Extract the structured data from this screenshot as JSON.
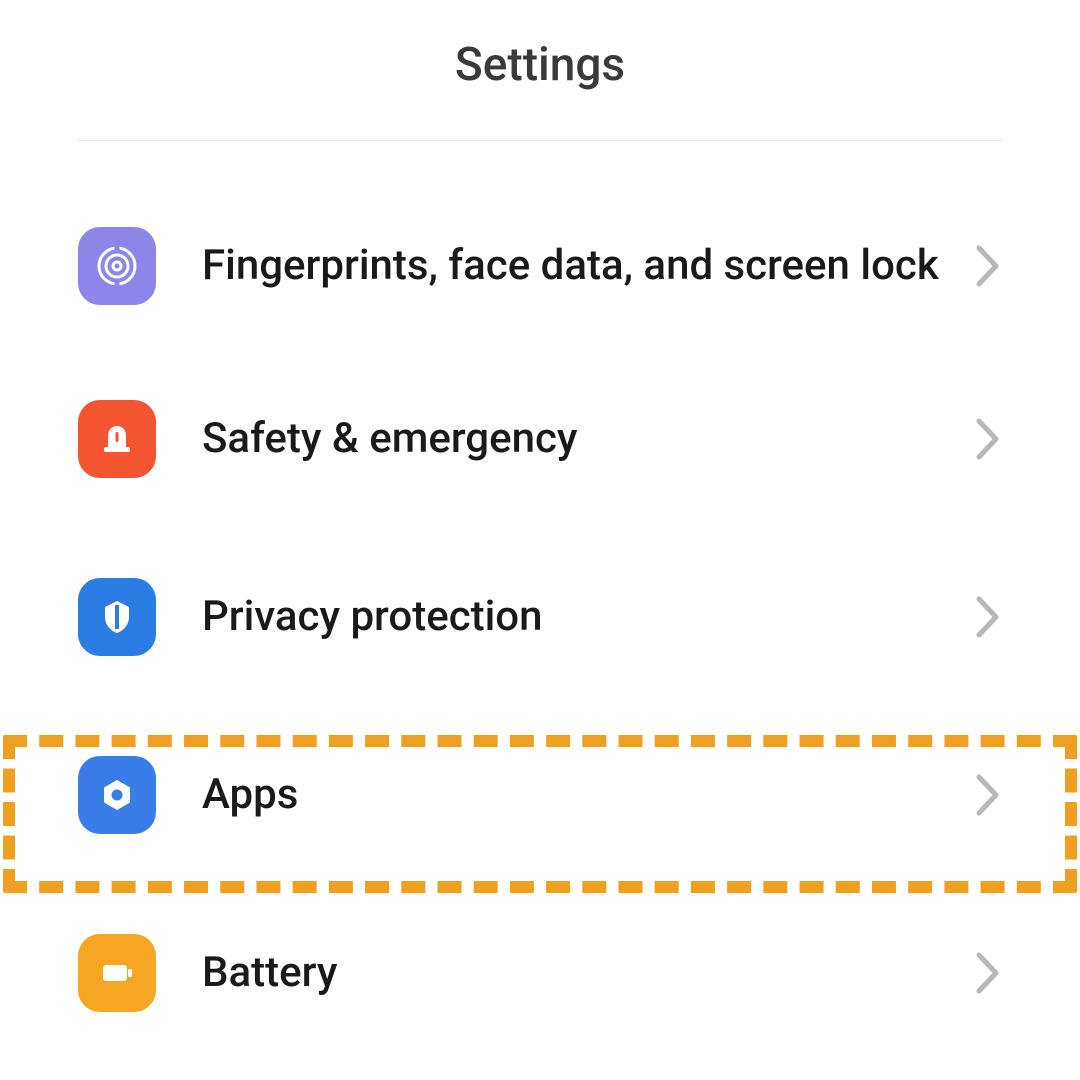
{
  "header": {
    "title": "Settings"
  },
  "list": {
    "items": [
      {
        "label": "Fingerprints, face data, and screen lock",
        "iconColor": "purple",
        "iconName": "fingerprint-icon"
      },
      {
        "label": "Safety & emergency",
        "iconColor": "orange",
        "iconName": "alert-icon"
      },
      {
        "label": "Privacy protection",
        "iconColor": "blue",
        "iconName": "shield-icon"
      },
      {
        "label": "Apps",
        "iconColor": "blue2",
        "iconName": "apps-icon",
        "highlighted": true
      },
      {
        "label": "Battery",
        "iconColor": "yellow",
        "iconName": "battery-icon"
      }
    ]
  },
  "highlightColor": "#f0a020"
}
